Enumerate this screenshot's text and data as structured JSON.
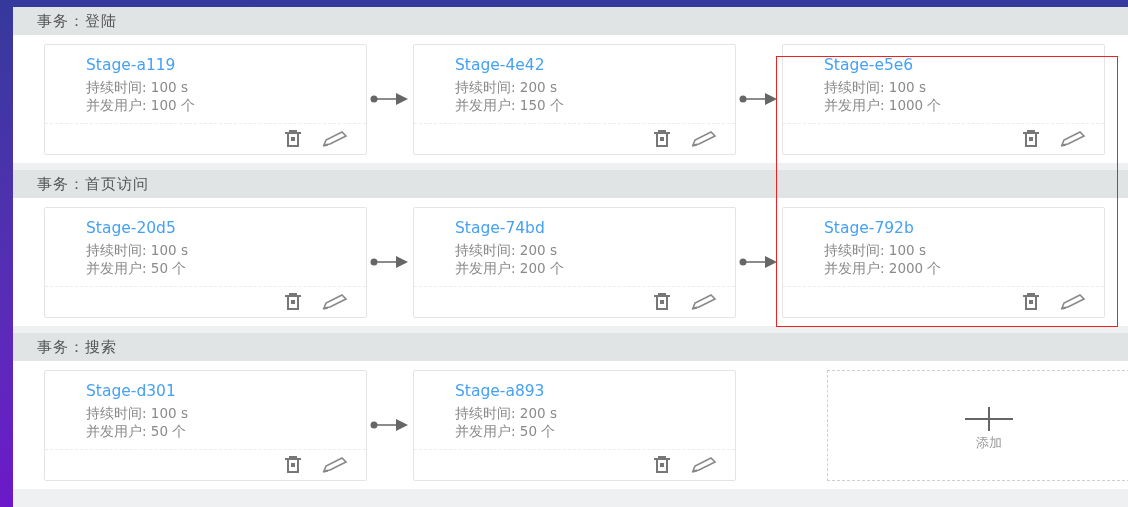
{
  "sections": [
    {
      "title": "事务：登陆",
      "stages": [
        {
          "name": "Stage-a119",
          "duration": "持续时间: 100 s",
          "users": "并发用户: 100 个"
        },
        {
          "name": "Stage-4e42",
          "duration": "持续时间: 200 s",
          "users": "并发用户: 150 个"
        },
        {
          "name": "Stage-e5e6",
          "duration": "持续时间: 100 s",
          "users": "并发用户: 1000 个"
        }
      ]
    },
    {
      "title": "事务：首页访问",
      "stages": [
        {
          "name": "Stage-20d5",
          "duration": "持续时间: 100 s",
          "users": "并发用户: 50 个"
        },
        {
          "name": "Stage-74bd",
          "duration": "持续时间: 200 s",
          "users": "并发用户: 200 个"
        },
        {
          "name": "Stage-792b",
          "duration": "持续时间: 100 s",
          "users": "并发用户: 2000 个"
        }
      ]
    },
    {
      "title": "事务：搜索",
      "stages": [
        {
          "name": "Stage-d301",
          "duration": "持续时间: 100 s",
          "users": "并发用户: 50 个"
        },
        {
          "name": "Stage-a893",
          "duration": "持续时间: 200 s",
          "users": "并发用户: 50 个"
        }
      ],
      "add_label": "添加"
    }
  ],
  "highlight": {
    "kind": "frame"
  }
}
